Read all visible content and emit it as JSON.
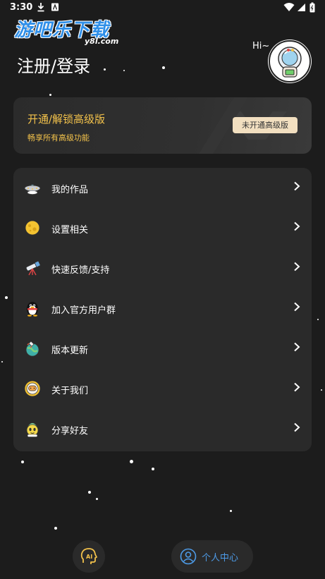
{
  "status_bar": {
    "time": "3:30",
    "icons": [
      "download-icon",
      "notification-a-icon",
      "wifi-icon",
      "signal-icon",
      "battery-icon"
    ]
  },
  "watermark": {
    "brand_cn": "游吧乐下载",
    "brand_en": "y8l.com"
  },
  "header": {
    "title": "注册/登录",
    "greeting": "Hi~",
    "avatar_icon": "astronaut-avatar-icon"
  },
  "vip": {
    "title": "开通/解锁高级版",
    "subtitle": "畅享所有高级功能",
    "button_label": "未开通高级版",
    "accent_color": "#f3c24b"
  },
  "menu": {
    "items": [
      {
        "label": "我的作品",
        "icon": "ufo-icon"
      },
      {
        "label": "设置相关",
        "icon": "moon-icon"
      },
      {
        "label": "快速反馈/支持",
        "icon": "telescope-icon"
      },
      {
        "label": "加入官方用户群",
        "icon": "qq-penguin-icon"
      },
      {
        "label": "版本更新",
        "icon": "planet-rocket-icon"
      },
      {
        "label": "关于我们",
        "icon": "astronaut-icon"
      },
      {
        "label": "分享好友",
        "icon": "alien-share-icon"
      }
    ]
  },
  "bottom_nav": {
    "ai_icon": "ai-head-icon",
    "personal_label": "个人中心",
    "personal_icon": "user-circle-icon",
    "active_color": "#4d9be8"
  }
}
